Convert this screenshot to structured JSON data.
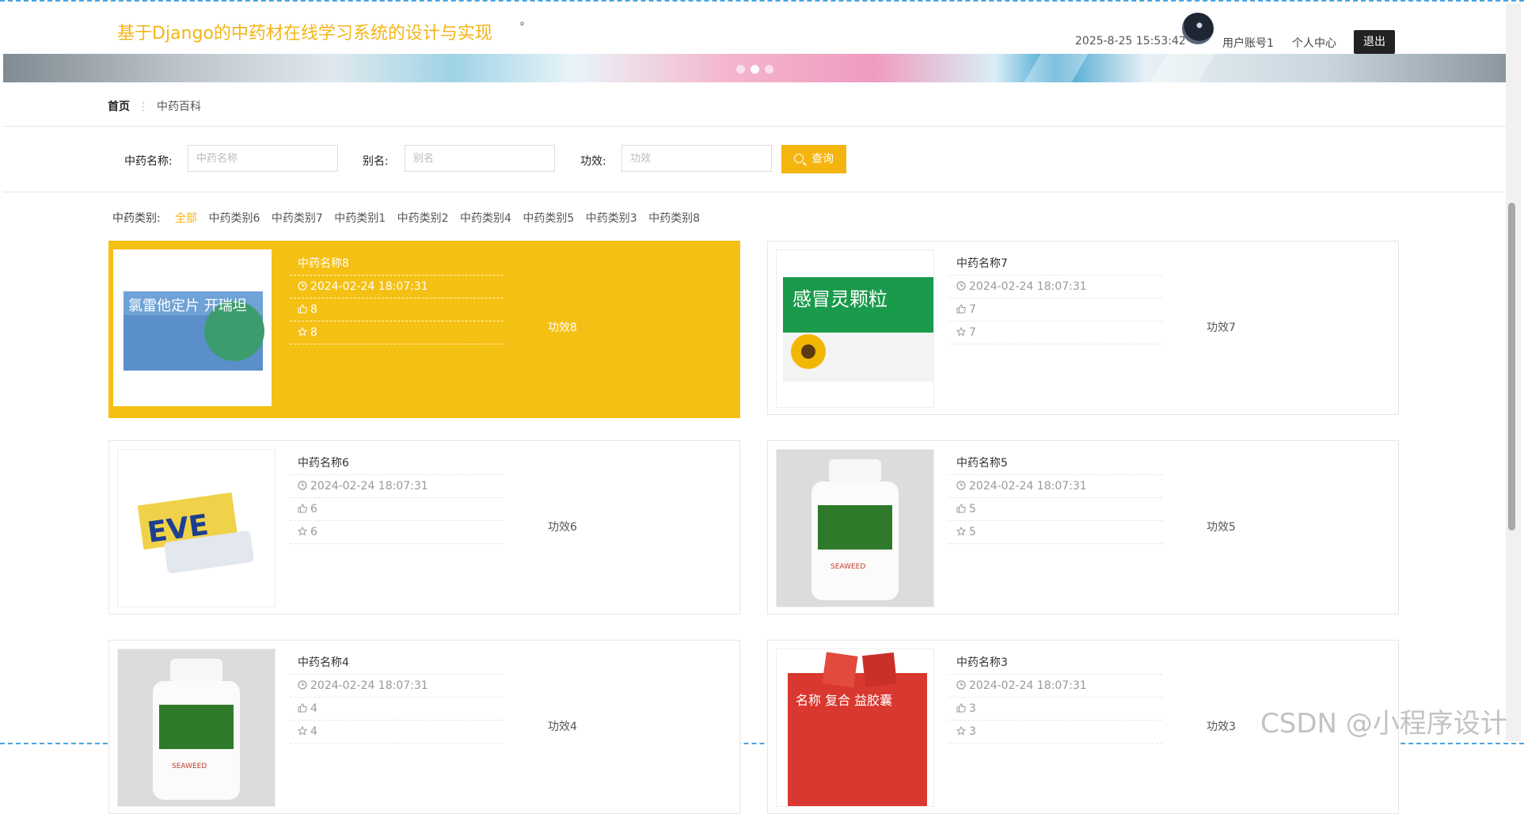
{
  "header": {
    "site_title": "基于Django的中药材在线学习系统的设计与实现",
    "title_dot": "°",
    "datetime": "2025-8-25 15:53:42",
    "account": "用户账号1",
    "personal_center": "个人中心",
    "logout": "退出"
  },
  "breadcrumb": {
    "home": "首页",
    "current": "中药百科"
  },
  "search": {
    "name_label": "中药名称:",
    "name_placeholder": "中药名称",
    "alias_label": "别名:",
    "alias_placeholder": "别名",
    "effect_label": "功效:",
    "effect_placeholder": "功效",
    "button": "查询"
  },
  "categories": {
    "label": "中药类别:",
    "items": [
      "全部",
      "中药类别6",
      "中药类别7",
      "中药类别1",
      "中药类别2",
      "中药类别4",
      "中药类别5",
      "中药类别3",
      "中药类别8"
    ]
  },
  "cards": [
    {
      "name": "中药名称8",
      "date": "2024-02-24 18:07:31",
      "likes": "8",
      "favorites": "8",
      "effect": "功效8",
      "image": "氯雷他定片 开瑞坦"
    },
    {
      "name": "中药名称7",
      "date": "2024-02-24 18:07:31",
      "likes": "7",
      "favorites": "7",
      "effect": "功效7",
      "image": "感冒灵颗粒"
    },
    {
      "name": "中药名称6",
      "date": "2024-02-24 18:07:31",
      "likes": "6",
      "favorites": "6",
      "effect": "功效6",
      "image": "EVE"
    },
    {
      "name": "中药名称5",
      "date": "2024-02-24 18:07:31",
      "likes": "5",
      "favorites": "5",
      "effect": "功效5",
      "image": "SEAWEED"
    },
    {
      "name": "中药名称4",
      "date": "2024-02-24 18:07:31",
      "likes": "4",
      "favorites": "4",
      "effect": "功效4",
      "image": "SEAWEED"
    },
    {
      "name": "中药名称3",
      "date": "2024-02-24 18:07:31",
      "likes": "3",
      "favorites": "3",
      "effect": "功效3",
      "image": "名称 复合 益胶囊"
    }
  ],
  "watermark": "CSDN @小程序设计",
  "colors": {
    "accent": "#f5b50f",
    "title": "#f4b516",
    "highlight": "#f5c014",
    "logout_bg": "#222222"
  }
}
